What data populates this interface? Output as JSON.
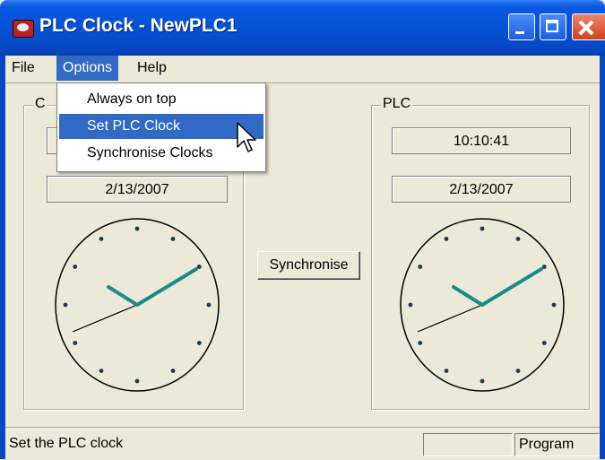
{
  "window": {
    "title": "PLC Clock - NewPLC1"
  },
  "menubar": {
    "items": [
      "File",
      "Options",
      "Help"
    ]
  },
  "options_menu": {
    "items": [
      "Always on top",
      "Set PLC Clock",
      "Synchronise Clocks"
    ],
    "highlighted": "Set PLC Clock"
  },
  "computer": {
    "label": "C",
    "time": "",
    "date": "2/13/2007"
  },
  "plc": {
    "label": "PLC",
    "time": "10:10:41",
    "date": "2/13/2007"
  },
  "synchronise_button": "Synchronise",
  "statusbar": {
    "message": "Set the PLC clock",
    "pane_empty": "",
    "mode": "Program"
  },
  "colors": {
    "titlebar": "#0552d4",
    "menu_highlight": "#316ac5",
    "clock_hands": "#1a8a8a",
    "face": "#ece9d8"
  },
  "icons": [
    "plc-clock-app-icon",
    "minimize-icon",
    "maximize-icon",
    "close-icon",
    "mouse-pointer-icon"
  ]
}
